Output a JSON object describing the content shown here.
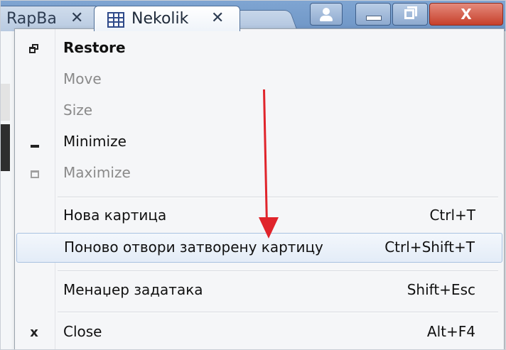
{
  "tabs": [
    {
      "label": "RapBa",
      "close": "✕"
    },
    {
      "label": "Nekolik",
      "close": "✕"
    }
  ],
  "menu": {
    "items": [
      {
        "label": "Restore",
        "shortcut": ""
      },
      {
        "label": "Move",
        "shortcut": ""
      },
      {
        "label": "Size",
        "shortcut": ""
      },
      {
        "label": "Minimize",
        "shortcut": ""
      },
      {
        "label": "Maximize",
        "shortcut": ""
      },
      {
        "label": "Нова картица",
        "shortcut": "Ctrl+T"
      },
      {
        "label": "Поново отвори затворену картицу",
        "shortcut": "Ctrl+Shift+T"
      },
      {
        "label": "Менаџер задатака",
        "shortcut": "Shift+Esc"
      },
      {
        "label": "Close",
        "shortcut": "Alt+F4"
      }
    ],
    "close_glyph": "x"
  },
  "window_controls": {
    "close_glyph": "X"
  },
  "colors": {
    "arrow": "#e0242b",
    "highlight_border": "#a9c2e0",
    "titlebar": "#7fa5d2",
    "close_button": "#c7402b"
  },
  "icons": {
    "restore": "restore-window-icon",
    "minimize": "minimize-icon",
    "maximize": "maximize-icon",
    "close": "close-icon"
  }
}
